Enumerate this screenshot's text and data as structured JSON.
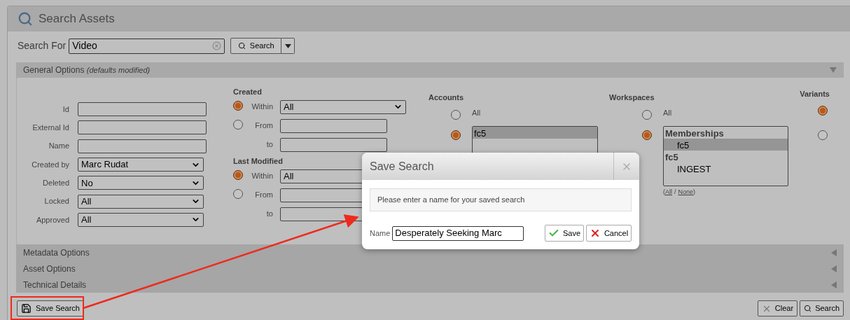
{
  "title": "Search Assets",
  "search": {
    "label": "Search For",
    "value": "Video",
    "button": "Search"
  },
  "general_options": {
    "title": "General Options",
    "note": "(defaults modified)",
    "expanded": true,
    "fields": [
      {
        "label": "Id",
        "kind": "text"
      },
      {
        "label": "External Id",
        "kind": "text"
      },
      {
        "label": "Name",
        "kind": "text"
      },
      {
        "label": "Created by",
        "kind": "select",
        "value": "Marc Rudat"
      },
      {
        "label": "Deleted",
        "kind": "select",
        "value": "No"
      },
      {
        "label": "Locked",
        "kind": "select",
        "value": "All"
      },
      {
        "label": "Approved",
        "kind": "select",
        "value": "All"
      }
    ],
    "date_groups": [
      {
        "title": "Created",
        "rows": [
          {
            "label": "Within",
            "kind": "select",
            "value": "All",
            "selected": true
          },
          {
            "label": "From",
            "kind": "text",
            "selected": false
          },
          {
            "label": "to",
            "kind": "end"
          }
        ]
      },
      {
        "title": "Last Modified",
        "rows": [
          {
            "label": "Within",
            "kind": "select",
            "value": "All",
            "selected": true
          },
          {
            "label": "From",
            "kind": "text",
            "selected": false
          },
          {
            "label": "to",
            "kind": "end"
          }
        ]
      }
    ],
    "accounts": {
      "title": "Accounts",
      "all": {
        "label": "All",
        "selected": false
      },
      "list": {
        "selected": true,
        "items": [
          {
            "label": "fc5",
            "selected": true
          }
        ]
      }
    },
    "workspaces": {
      "title": "Workspaces",
      "all": {
        "label": "All",
        "selected": false
      },
      "list": {
        "selected": true,
        "items": [
          {
            "label": "Memberships",
            "children": [
              {
                "label": "fc5",
                "selected": true
              }
            ]
          },
          {
            "label": "fc5",
            "children": [
              {
                "label": "INGEST",
                "selected": false
              }
            ]
          }
        ]
      },
      "links": [
        "All",
        "None"
      ],
      "link_open": "(",
      "link_separator": "/",
      "link_close": ")"
    },
    "variants": {
      "title": "Variants",
      "options": [
        {
          "selected": true
        },
        {
          "selected": false
        }
      ]
    }
  },
  "sections": [
    {
      "title": "Metadata Options",
      "expanded": false
    },
    {
      "title": "Asset Options",
      "expanded": false
    },
    {
      "title": "Technical Details",
      "expanded": false
    }
  ],
  "footer": {
    "save_search": "Save Search",
    "clear": "Clear",
    "search": "Search"
  },
  "dialog": {
    "title": "Save Search",
    "message": "Please enter a name for your saved search",
    "name_label": "Name",
    "name_value": "Desperately Seeking Marc",
    "save": "Save",
    "cancel": "Cancel"
  }
}
